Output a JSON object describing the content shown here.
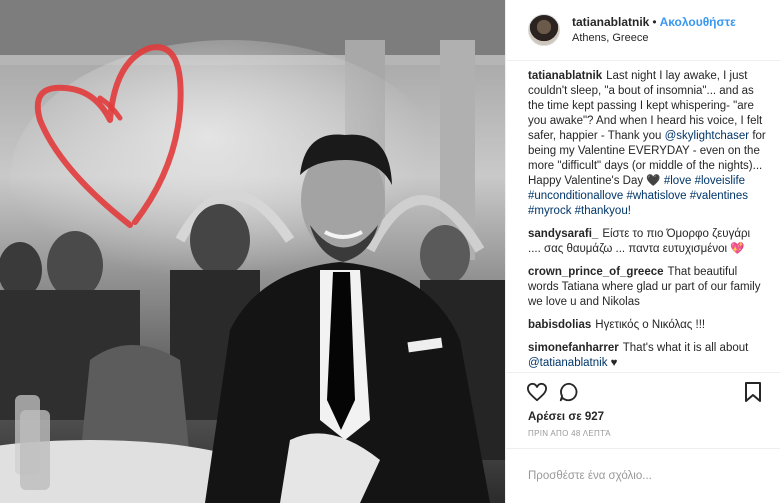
{
  "header": {
    "username": "tatianablatnik",
    "separator": "•",
    "follow_label": "Ακολουθήστε",
    "location": "Athens, Greece"
  },
  "caption": {
    "username": "tatianablatnik",
    "text_part1": "Last night I lay awake, I just couldn't sleep, \"a bout of insomnia\"... and as the time kept passing I kept whispering- \"are you awake\"? And when I heard his voice, I felt safer, happier - Thank you ",
    "mention": "@skylightchaser",
    "text_part2": " for being my Valentine EVERYDAY - even on the more \"difficult\" days (or middle of the nights)... Happy Valentine's Day ",
    "heart": "🖤",
    "hashtags": [
      "#love",
      "#loveislife",
      "#unconditionallove",
      "#whatislove",
      "#valentines",
      "#myrock",
      "#thankyou!"
    ]
  },
  "comments": [
    {
      "username": "sandysarafi_",
      "text": "Είστε το πιο Όμορφο ζευγάρι .... σας θαυμάζω ... παντα ευτυχισμένοι 💖"
    },
    {
      "username": "crown_prince_of_greece",
      "text": "That beautiful words Tatiana where glad ur part of our family we love u and Nikolas"
    },
    {
      "username": "babisdolias",
      "text": "Ηγετικός ο Νικόλας !!!"
    },
    {
      "username": "simonefanharrer",
      "text": "That's what it is all about",
      "mention": "@tatianablatnik",
      "suffix": " ♥"
    }
  ],
  "likes": "Αρέσει σε 927",
  "time_ago": "ΠΡΙΝ ΑΠΟ 48 ΛΕΠΤΆ",
  "add_comment_placeholder": "Προσθέστε ένα σχόλιο...",
  "colors": {
    "accent": "#3897f0",
    "link": "#003569",
    "heart_drawing": "#e23b3b"
  }
}
